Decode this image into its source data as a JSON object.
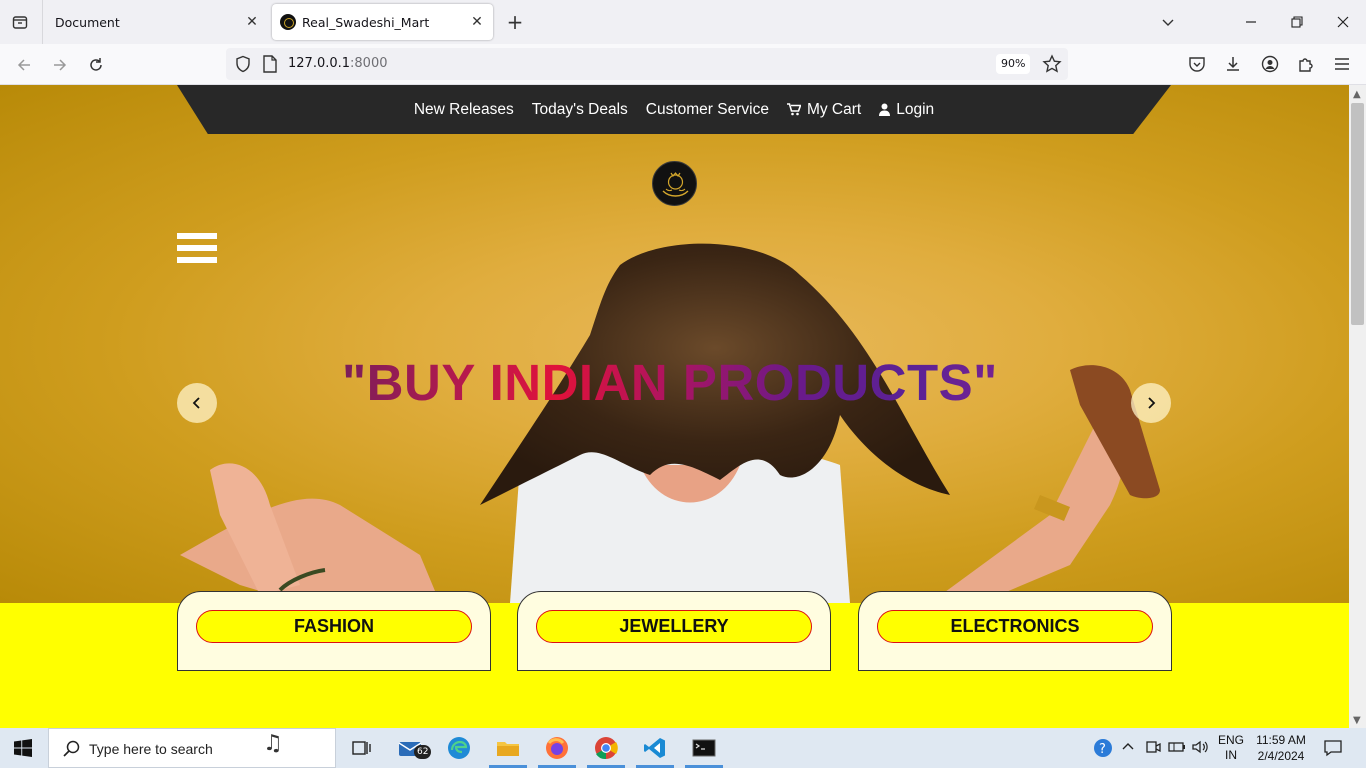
{
  "browser": {
    "tabs": [
      {
        "title": "Document",
        "active": false
      },
      {
        "title": "Real_Swadeshi_Mart",
        "active": true
      }
    ],
    "url_host": "127.0.0.1",
    "url_port": ":8000",
    "zoom": "90%"
  },
  "site": {
    "nav": {
      "new_releases": "New Releases",
      "todays_deals": "Today's Deals",
      "customer_service": "Customer Service",
      "my_cart": "My Cart",
      "login": "Login"
    },
    "hero": {
      "headline": "\"BUY INDIAN PRODUCTS\""
    },
    "categories": [
      "FASHION",
      "JEWELLERY",
      "ELECTRONICS"
    ],
    "colors": {
      "hero_bg": "#e0ad3e",
      "nav_bg": "#282828",
      "section_bg": "#ffff00",
      "pill_border": "#dd1111"
    }
  },
  "taskbar": {
    "search_placeholder": "Type here to search",
    "mail_badge": "62",
    "lang_top": "ENG",
    "lang_bottom": "IN",
    "time": "11:59 AM",
    "date": "2/4/2024"
  }
}
